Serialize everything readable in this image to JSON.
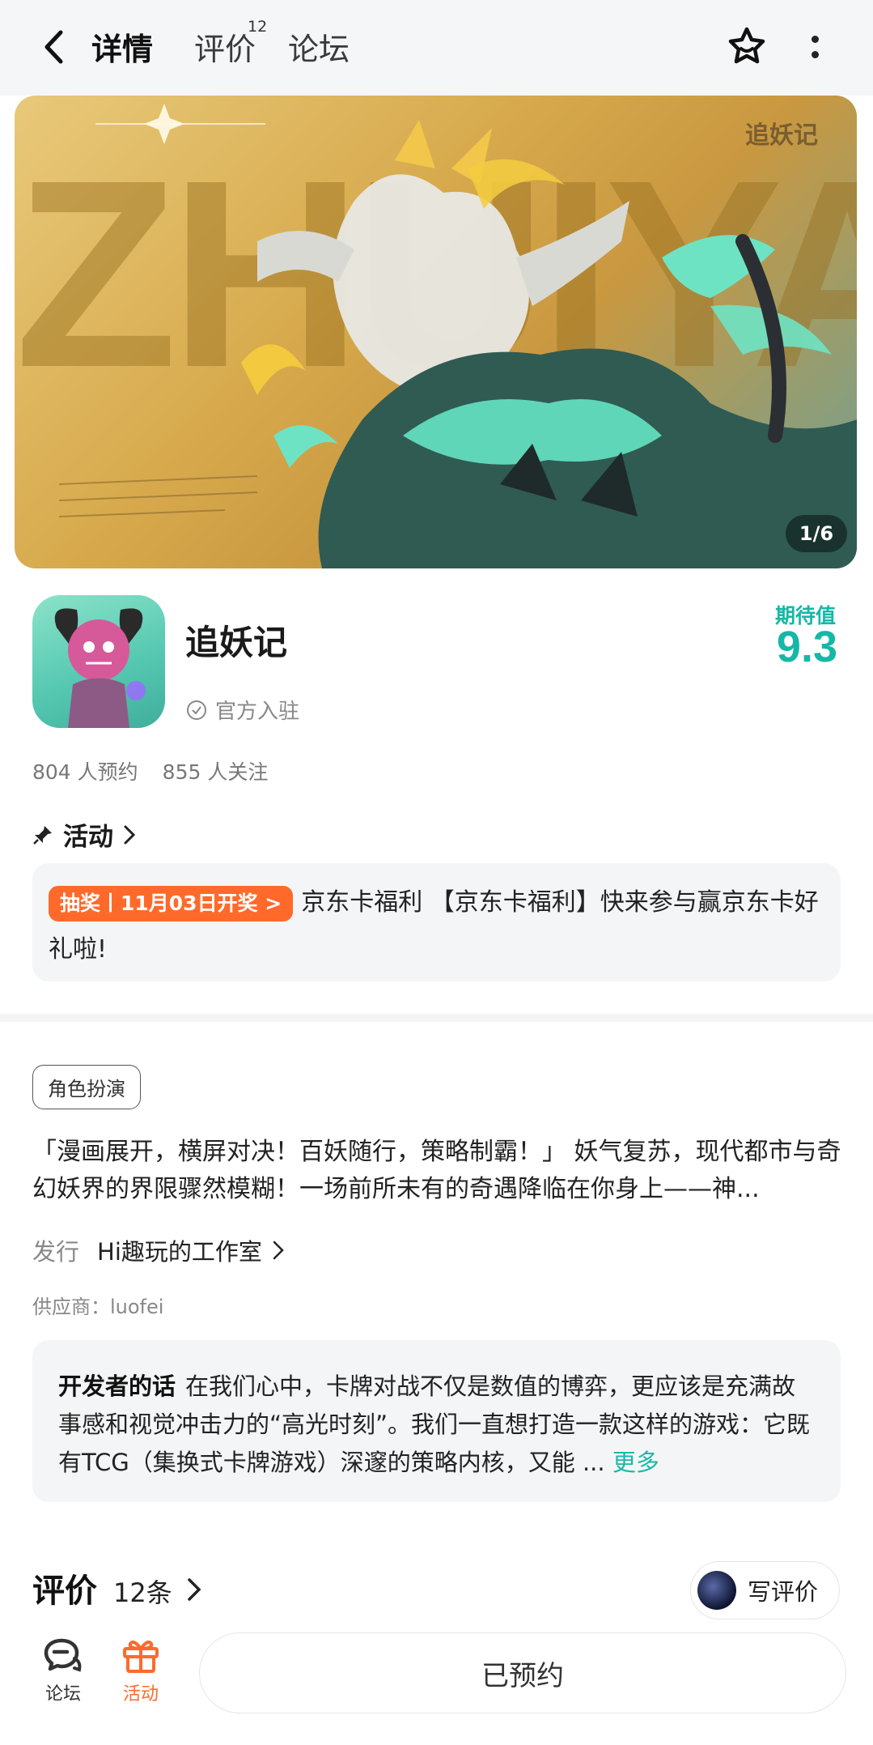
{
  "header": {
    "tabs": {
      "detail": "详情",
      "review": "评价",
      "review_count": "12",
      "forum": "论坛"
    }
  },
  "banner": {
    "big_text": "ZHUIYAOJI",
    "logo_text": "追妖记",
    "counter": "1/6"
  },
  "game": {
    "title": "追妖记",
    "official": "官方入驻",
    "expect_label": "期待值",
    "expect_score": "9.3",
    "reservations": "804 人预约",
    "followers": "855 人关注"
  },
  "activity": {
    "header": "活动",
    "badge": "抽奖丨11月03日开奖 >",
    "text": "京东卡福利 【京东卡福利】快来参与赢京东卡好礼啦!"
  },
  "tag": "角色扮演",
  "description": "「漫画展开，横屏对决！百妖随行，策略制霸！」 妖气复苏，现代都市与奇幻妖界的界限骤然模糊！一场前所未有的奇遇降临在你身上——神...",
  "publisher": {
    "label": "发行",
    "value": "Hi趣玩的工作室"
  },
  "supplier": "供应商：luofei",
  "developer_note": {
    "title": "开发者的话",
    "text": "在我们心中，卡牌对战不仅是数值的博弈，更应该是充满故事感和视觉冲击力的“高光时刻”。我们一直想打造一款这样的游戏：它既有TCG（集换式卡牌游戏）深邃的策略内核，又能 ...",
    "more": "更多"
  },
  "reviews": {
    "title": "评价",
    "count": "12条",
    "write": "写评价"
  },
  "bottom": {
    "forum": "论坛",
    "activity": "活动",
    "reserved": "已预约"
  },
  "colors": {
    "accent": "#19c2b0",
    "orange": "#ff6a2b"
  }
}
